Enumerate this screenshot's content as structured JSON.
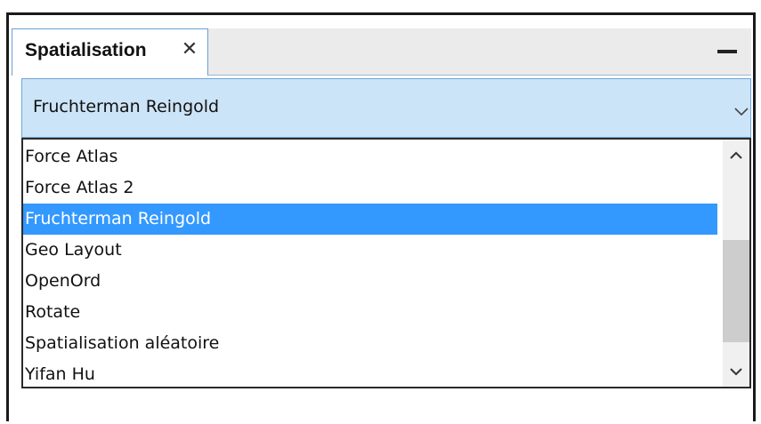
{
  "panel": {
    "tab_label": "Spatialisation",
    "close_glyph": "✕",
    "minimize_icon": "minimize-icon"
  },
  "combo": {
    "selected_value": "Fruchterman Reingold",
    "arrow_icon": "chevron-down-icon"
  },
  "list": {
    "items": [
      {
        "label": "Force Atlas",
        "selected": false
      },
      {
        "label": "Force Atlas 2",
        "selected": false
      },
      {
        "label": "Fruchterman Reingold",
        "selected": true
      },
      {
        "label": "Geo Layout",
        "selected": false
      },
      {
        "label": "OpenOrd",
        "selected": false
      },
      {
        "label": "Rotate",
        "selected": false
      },
      {
        "label": "Spatialisation aléatoire",
        "selected": false
      },
      {
        "label": "Yifan Hu",
        "selected": false
      }
    ]
  },
  "colors": {
    "selection": "#3399ff",
    "combo_background": "#cce4f7",
    "tab_border": "#6a9fd4"
  }
}
